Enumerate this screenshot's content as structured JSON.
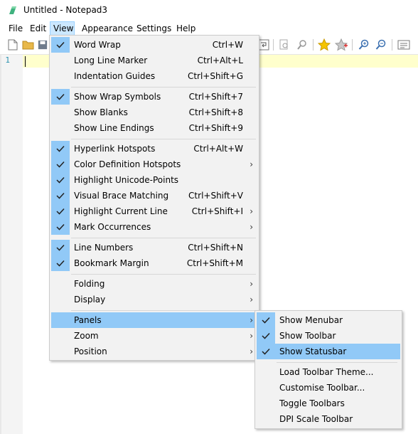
{
  "window": {
    "title": "Untitled - Notepad3"
  },
  "menubar": {
    "file": "File",
    "edit": "Edit",
    "view": "View",
    "appearance": "Appearance",
    "settings": "Settings",
    "help": "Help"
  },
  "editor": {
    "first_line_number": "1"
  },
  "colors": {
    "highlight": "#91c9f7",
    "menu_bg": "#f2f2f2",
    "current_line": "#ffffcc",
    "line_number": "#2b91af"
  },
  "view_menu": {
    "word_wrap": {
      "label": "Word Wrap",
      "shortcut": "Ctrl+W",
      "checked": true
    },
    "long_line_marker": {
      "label": "Long Line Marker",
      "shortcut": "Ctrl+Alt+L",
      "checked": false
    },
    "indentation_guides": {
      "label": "Indentation Guides",
      "shortcut": "Ctrl+Shift+G",
      "checked": false
    },
    "show_wrap_symbols": {
      "label": "Show Wrap Symbols",
      "shortcut": "Ctrl+Shift+7",
      "checked": true
    },
    "show_blanks": {
      "label": "Show Blanks",
      "shortcut": "Ctrl+Shift+8",
      "checked": false
    },
    "show_line_endings": {
      "label": "Show Line Endings",
      "shortcut": "Ctrl+Shift+9",
      "checked": false
    },
    "hyperlink_hotspots": {
      "label": "Hyperlink Hotspots",
      "shortcut": "Ctrl+Alt+W",
      "checked": true
    },
    "color_definition_hotspots": {
      "label": "Color Definition Hotspots",
      "checked": true
    },
    "highlight_unicode_points": {
      "label": "Highlight Unicode-Points",
      "checked": true
    },
    "visual_brace_matching": {
      "label": "Visual Brace Matching",
      "shortcut": "Ctrl+Shift+V",
      "checked": true
    },
    "highlight_current_line": {
      "label": "Highlight Current Line",
      "shortcut": "Ctrl+Shift+I",
      "checked": true
    },
    "mark_occurrences": {
      "label": "Mark Occurrences",
      "checked": true
    },
    "line_numbers": {
      "label": "Line Numbers",
      "shortcut": "Ctrl+Shift+N",
      "checked": true
    },
    "bookmark_margin": {
      "label": "Bookmark Margin",
      "shortcut": "Ctrl+Shift+M",
      "checked": true
    },
    "folding": {
      "label": "Folding"
    },
    "display": {
      "label": "Display"
    },
    "panels": {
      "label": "Panels"
    },
    "zoom": {
      "label": "Zoom"
    },
    "position": {
      "label": "Position"
    }
  },
  "panels_menu": {
    "show_menubar": {
      "label": "Show Menubar",
      "checked": true
    },
    "show_toolbar": {
      "label": "Show Toolbar",
      "checked": true
    },
    "show_statusbar": {
      "label": "Show Statusbar",
      "checked": true
    },
    "load_toolbar_theme": {
      "label": "Load Toolbar Theme..."
    },
    "customise_toolbar": {
      "label": "Customise Toolbar..."
    },
    "toggle_toolbars": {
      "label": "Toggle Toolbars"
    },
    "dpi_scale_toolbar": {
      "label": "DPI Scale Toolbar"
    }
  }
}
